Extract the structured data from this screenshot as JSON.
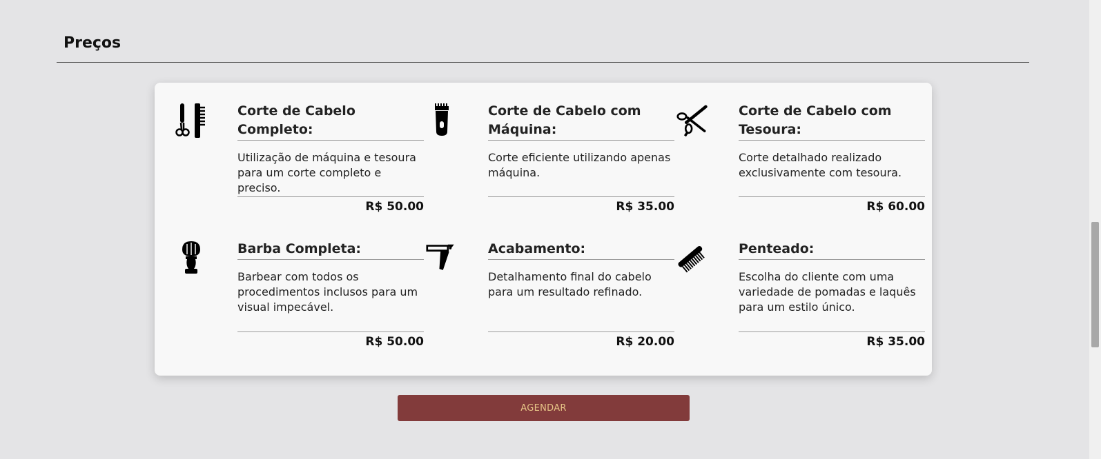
{
  "section": {
    "title": "Preços"
  },
  "services": [
    {
      "icon": "comb-and-scissors-icon",
      "title": "Corte de Cabelo Completo:",
      "description": "Utilização de máquina e tesoura para um corte completo e preciso.",
      "price": "R$ 50.00"
    },
    {
      "icon": "hair-clipper-icon",
      "title": "Corte de Cabelo com Máquina:",
      "description": "Corte eficiente utilizando apenas máquina.",
      "price": "R$ 35.00"
    },
    {
      "icon": "scissors-icon",
      "title": "Corte de Cabelo com Tesoura:",
      "description": "Corte detalhado realizado exclusivamente com tesoura.",
      "price": "R$ 60.00"
    },
    {
      "icon": "shaving-brush-icon",
      "title": "Barba Completa:",
      "description": "Barbear com todos os procedimentos inclusos para um visual impecável.",
      "price": "R$ 50.00"
    },
    {
      "icon": "straight-razor-icon",
      "title": "Acabamento:",
      "description": "Detalhamento final do cabelo para um resultado refinado.",
      "price": "R$ 20.00"
    },
    {
      "icon": "comb-icon",
      "title": "Penteado:",
      "description": "Escolha do cliente com uma variedade de pomadas e laquês para um estilo único.",
      "price": "R$ 35.00"
    }
  ],
  "cta": {
    "label": "AGENDAR"
  },
  "colors": {
    "button_bg": "#823b3b",
    "button_text": "#e6c487",
    "page_bg": "#e4e4e6",
    "card_bg": "#f8f8f8"
  }
}
